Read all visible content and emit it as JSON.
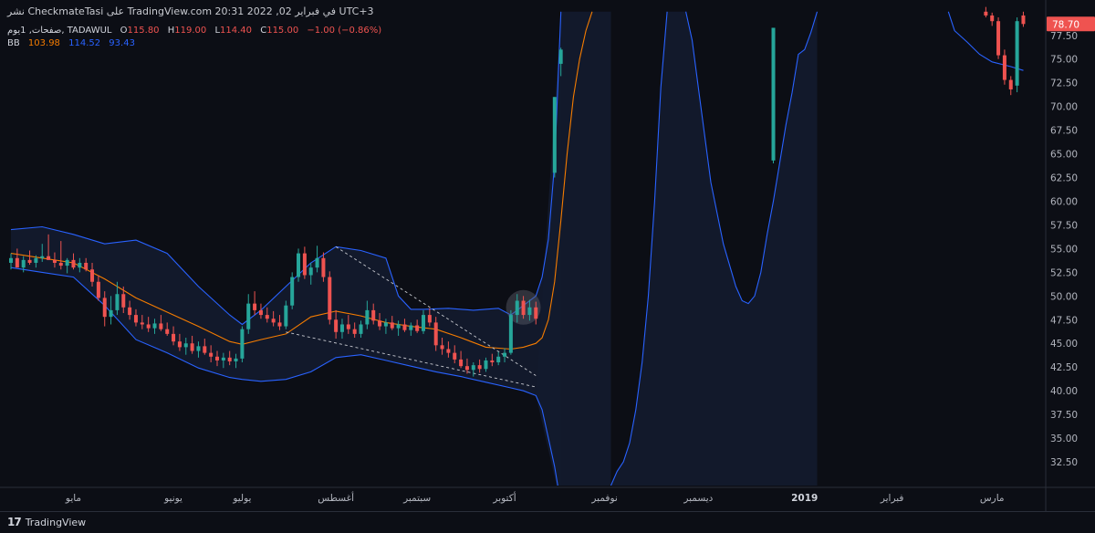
{
  "header": {
    "published_line": "نشر CheckmateTasi على TradingView.com 20:31 2022 ,02 في فبراير UTC+3"
  },
  "legend": {
    "symbol": "صفحات, 1يوم, TADAWUL",
    "open_label": "O",
    "open": "115.80",
    "high_label": "H",
    "high": "119.00",
    "low_label": "L",
    "low": "114.40",
    "close_label": "C",
    "close": "115.00",
    "change": "−1.00 (−0.86%)",
    "bb_label": "BB",
    "bb_basis": "103.98",
    "bb_upper": "114.52",
    "bb_lower": "93.43"
  },
  "price_badge": "78.70",
  "footer": {
    "brand": "TradingView",
    "logo_icon": "tradingview-logo-icon"
  },
  "colors": {
    "background": "#0c0e15",
    "up": "#26a69a",
    "down": "#ef5350",
    "basis": "#f57c00",
    "band": "#2962ff",
    "band_fill": "#131b2e",
    "grid": "#1b1e27",
    "axis_text": "#b2b5be",
    "badge": "#ef5350"
  },
  "chart_data": {
    "type": "candlestick",
    "title": "",
    "xlabel": "",
    "ylabel": "",
    "ylim": [
      30.0,
      79.5
    ],
    "grid": false,
    "y_ticks": [
      "32.50",
      "35.00",
      "37.50",
      "40.00",
      "42.50",
      "45.00",
      "47.50",
      "50.00",
      "52.50",
      "55.00",
      "57.50",
      "60.00",
      "62.50",
      "65.00",
      "67.50",
      "70.00",
      "72.50",
      "75.00",
      "77.50"
    ],
    "x_tick_labels": [
      {
        "label": "مايو",
        "i": 10
      },
      {
        "label": "يونيو",
        "i": 26
      },
      {
        "label": "يوليو",
        "i": 37
      },
      {
        "label": "أغسطس",
        "i": 52
      },
      {
        "label": "سبتمبر",
        "i": 65
      },
      {
        "label": "أكتوبر",
        "i": 79
      },
      {
        "label": "نوفمبر",
        "i": 95
      },
      {
        "label": "ديسمبر",
        "i": 110
      },
      {
        "label": "2019",
        "i": 127
      },
      {
        "label": "فبراير",
        "i": 141
      },
      {
        "label": "مارس",
        "i": 157
      }
    ],
    "candles": [
      [
        0,
        53.5,
        54.5,
        52.8,
        54.0
      ],
      [
        1,
        54.0,
        55.0,
        53.2,
        53.0
      ],
      [
        2,
        53.0,
        54.2,
        52.5,
        53.8
      ],
      [
        3,
        53.8,
        54.8,
        53.3,
        53.5
      ],
      [
        4,
        53.5,
        54.3,
        53.0,
        54.0
      ],
      [
        5,
        54.0,
        55.5,
        53.6,
        54.2
      ],
      [
        6,
        54.2,
        56.5,
        53.8,
        53.8
      ],
      [
        7,
        53.8,
        54.6,
        53.0,
        53.5
      ],
      [
        8,
        53.5,
        55.8,
        52.8,
        53.2
      ],
      [
        9,
        53.2,
        54.0,
        52.4,
        53.8
      ],
      [
        10,
        53.8,
        54.5,
        52.8,
        53.0
      ],
      [
        11,
        53.0,
        54.0,
        52.5,
        53.5
      ],
      [
        12,
        53.5,
        54.0,
        52.6,
        52.8
      ],
      [
        13,
        52.8,
        53.5,
        51.0,
        51.5
      ],
      [
        14,
        51.5,
        52.2,
        49.5,
        49.8
      ],
      [
        15,
        49.8,
        50.5,
        46.8,
        47.8
      ],
      [
        16,
        47.8,
        50.0,
        47.0,
        48.5
      ],
      [
        17,
        48.5,
        51.5,
        48.0,
        50.2
      ],
      [
        18,
        50.2,
        51.0,
        48.2,
        48.8
      ],
      [
        19,
        48.8,
        49.5,
        47.5,
        48.0
      ],
      [
        20,
        48.0,
        48.6,
        46.8,
        47.2
      ],
      [
        21,
        47.2,
        48.0,
        46.5,
        47.0
      ],
      [
        22,
        47.0,
        47.8,
        46.2,
        46.6
      ],
      [
        23,
        46.6,
        47.6,
        46.0,
        47.1
      ],
      [
        24,
        47.1,
        48.0,
        46.3,
        46.5
      ],
      [
        25,
        46.5,
        47.2,
        45.8,
        46.0
      ],
      [
        26,
        46.0,
        46.8,
        44.8,
        45.2
      ],
      [
        27,
        45.2,
        46.0,
        44.2,
        44.6
      ],
      [
        28,
        44.6,
        45.6,
        43.8,
        45.0
      ],
      [
        29,
        45.0,
        45.8,
        43.9,
        44.2
      ],
      [
        30,
        44.2,
        45.2,
        43.5,
        44.7
      ],
      [
        31,
        44.7,
        45.5,
        43.8,
        44.0
      ],
      [
        32,
        44.0,
        44.8,
        43.0,
        43.6
      ],
      [
        33,
        43.6,
        44.2,
        42.6,
        43.2
      ],
      [
        34,
        43.2,
        44.0,
        42.4,
        43.5
      ],
      [
        35,
        43.5,
        44.2,
        42.7,
        43.1
      ],
      [
        36,
        43.1,
        43.9,
        42.4,
        43.4
      ],
      [
        37,
        43.4,
        46.8,
        43.0,
        46.5
      ],
      [
        38,
        46.5,
        50.2,
        46.0,
        49.2
      ],
      [
        39,
        49.2,
        50.5,
        48.0,
        48.5
      ],
      [
        40,
        48.5,
        49.2,
        47.6,
        48.0
      ],
      [
        41,
        48.0,
        48.8,
        47.2,
        47.6
      ],
      [
        42,
        47.6,
        48.4,
        46.8,
        47.2
      ],
      [
        43,
        47.2,
        48.0,
        46.4,
        46.8
      ],
      [
        44,
        46.8,
        49.5,
        46.5,
        49.0
      ],
      [
        45,
        49.0,
        52.5,
        48.6,
        52.0
      ],
      [
        46,
        52.0,
        55.0,
        51.5,
        54.5
      ],
      [
        47,
        54.5,
        55.2,
        51.8,
        52.2
      ],
      [
        48,
        52.2,
        53.5,
        51.2,
        53.0
      ],
      [
        49,
        53.0,
        55.3,
        52.5,
        54.0
      ],
      [
        50,
        54.0,
        54.6,
        51.5,
        52.0
      ],
      [
        51,
        52.0,
        52.6,
        47.0,
        47.5
      ],
      [
        52,
        47.5,
        48.5,
        45.5,
        46.2
      ],
      [
        53,
        46.2,
        47.6,
        45.5,
        47.0
      ],
      [
        54,
        47.0,
        48.0,
        46.0,
        46.5
      ],
      [
        55,
        46.5,
        47.2,
        45.6,
        46.0
      ],
      [
        56,
        46.0,
        47.4,
        45.6,
        47.0
      ],
      [
        57,
        47.0,
        49.5,
        46.5,
        48.5
      ],
      [
        58,
        48.5,
        49.2,
        47.0,
        47.4
      ],
      [
        59,
        47.4,
        48.2,
        46.4,
        46.8
      ],
      [
        60,
        46.8,
        47.6,
        46.0,
        47.2
      ],
      [
        61,
        47.2,
        47.9,
        46.4,
        46.6
      ],
      [
        62,
        46.6,
        47.4,
        45.8,
        47.0
      ],
      [
        63,
        47.0,
        47.6,
        46.2,
        46.4
      ],
      [
        64,
        46.4,
        47.2,
        45.8,
        46.9
      ],
      [
        65,
        46.9,
        47.5,
        46.1,
        46.3
      ],
      [
        66,
        46.3,
        48.5,
        46.0,
        48.0
      ],
      [
        67,
        48.0,
        48.7,
        46.8,
        47.2
      ],
      [
        68,
        47.2,
        47.8,
        44.2,
        44.8
      ],
      [
        69,
        44.8,
        45.6,
        43.8,
        44.4
      ],
      [
        70,
        44.4,
        45.2,
        43.5,
        44.0
      ],
      [
        71,
        44.0,
        44.8,
        42.9,
        43.3
      ],
      [
        72,
        43.3,
        44.2,
        42.4,
        42.6
      ],
      [
        73,
        42.6,
        43.4,
        41.8,
        42.2
      ],
      [
        74,
        42.2,
        43.0,
        41.5,
        42.7
      ],
      [
        75,
        42.7,
        43.3,
        41.9,
        42.3
      ],
      [
        76,
        42.3,
        43.5,
        42.0,
        43.2
      ],
      [
        77,
        43.2,
        43.9,
        42.6,
        43.0
      ],
      [
        78,
        43.0,
        44.1,
        42.7,
        43.6
      ],
      [
        79,
        43.6,
        44.5,
        43.0,
        44.0
      ],
      [
        80,
        44.0,
        48.5,
        43.8,
        48.0
      ],
      [
        81,
        48.0,
        50.2,
        47.2,
        49.5
      ],
      [
        82,
        49.5,
        50.0,
        47.6,
        48.0
      ],
      [
        83,
        48.0,
        49.6,
        47.4,
        48.8
      ],
      [
        84,
        48.8,
        49.4,
        47.0,
        47.6
      ],
      [
        87,
        63.0,
        71.0,
        62.5,
        71.0
      ],
      [
        88,
        74.5,
        76.2,
        73.2,
        76.0
      ],
      [
        122,
        64.3,
        78.3,
        64.0,
        78.3
      ],
      [
        156,
        80.0,
        80.5,
        79.4,
        79.6
      ],
      [
        157,
        79.6,
        79.9,
        78.5,
        79.0
      ],
      [
        158,
        79.0,
        79.4,
        75.0,
        75.4
      ],
      [
        159,
        75.4,
        76.0,
        72.3,
        72.8
      ],
      [
        160,
        72.8,
        73.2,
        71.2,
        71.8
      ],
      [
        161,
        72.2,
        79.4,
        71.5,
        79.0
      ],
      [
        162,
        79.6,
        80.0,
        78.4,
        78.7
      ]
    ],
    "series": [
      {
        "name": "",
        "role": "upper",
        "points": [
          [
            0,
            57.0
          ],
          [
            5,
            57.3
          ],
          [
            10,
            56.5
          ],
          [
            15,
            55.5
          ],
          [
            20,
            55.9
          ],
          [
            25,
            54.5
          ],
          [
            30,
            51.0
          ],
          [
            35,
            48.0
          ],
          [
            37,
            47.0
          ],
          [
            40,
            48.5
          ],
          [
            44,
            51.0
          ],
          [
            48,
            53.5
          ],
          [
            52,
            55.2
          ],
          [
            56,
            54.8
          ],
          [
            60,
            54.0
          ],
          [
            62,
            50.0
          ],
          [
            64,
            48.6
          ],
          [
            66,
            48.6
          ],
          [
            70,
            48.7
          ],
          [
            74,
            48.5
          ],
          [
            78,
            48.7
          ],
          [
            80,
            48.0
          ],
          [
            82,
            49.0
          ],
          [
            84,
            50.0
          ],
          [
            85,
            52.0
          ],
          [
            86,
            56.0
          ],
          [
            87,
            64.0
          ],
          [
            88,
            80.0
          ]
        ]
      },
      {
        "name": "",
        "role": "basis",
        "points": [
          [
            0,
            54.5
          ],
          [
            5,
            54.0
          ],
          [
            10,
            53.5
          ],
          [
            15,
            51.8
          ],
          [
            20,
            49.8
          ],
          [
            25,
            48.3
          ],
          [
            30,
            46.8
          ],
          [
            35,
            45.2
          ],
          [
            37,
            44.9
          ],
          [
            40,
            45.4
          ],
          [
            44,
            46.0
          ],
          [
            48,
            47.8
          ],
          [
            52,
            48.4
          ],
          [
            56,
            47.9
          ],
          [
            60,
            47.2
          ],
          [
            64,
            46.8
          ],
          [
            68,
            46.5
          ],
          [
            72,
            45.6
          ],
          [
            76,
            44.6
          ],
          [
            80,
            44.4
          ],
          [
            82,
            44.6
          ],
          [
            84,
            45.0
          ],
          [
            85,
            45.6
          ],
          [
            86,
            47.5
          ],
          [
            87,
            51.5
          ],
          [
            88,
            58.0
          ],
          [
            89,
            65.0
          ],
          [
            90,
            71.0
          ],
          [
            91,
            75.0
          ],
          [
            92,
            78.0
          ],
          [
            93,
            80.0
          ]
        ]
      },
      {
        "name": "",
        "role": "lower",
        "points": [
          [
            0,
            53.0
          ],
          [
            5,
            52.5
          ],
          [
            10,
            52.0
          ],
          [
            15,
            49.0
          ],
          [
            20,
            45.4
          ],
          [
            25,
            44.0
          ],
          [
            30,
            42.4
          ],
          [
            35,
            41.4
          ],
          [
            37,
            41.2
          ],
          [
            40,
            41.0
          ],
          [
            44,
            41.2
          ],
          [
            48,
            42.0
          ],
          [
            52,
            43.5
          ],
          [
            56,
            43.8
          ],
          [
            60,
            43.2
          ],
          [
            64,
            42.6
          ],
          [
            68,
            42.0
          ],
          [
            72,
            41.5
          ],
          [
            76,
            40.9
          ],
          [
            80,
            40.3
          ],
          [
            82,
            40.0
          ],
          [
            84,
            39.5
          ],
          [
            85,
            38.0
          ],
          [
            86,
            35.0
          ],
          [
            87,
            32.0
          ],
          [
            88,
            28.0
          ]
        ]
      },
      {
        "name": "",
        "role": "upper",
        "points": [
          [
            108,
            80.0
          ],
          [
            109,
            77.0
          ],
          [
            110,
            72.0
          ],
          [
            112,
            62.0
          ],
          [
            114,
            55.5
          ],
          [
            116,
            51.0
          ],
          [
            117,
            49.5
          ],
          [
            118,
            49.2
          ],
          [
            119,
            50.0
          ],
          [
            120,
            52.5
          ],
          [
            121,
            56.5
          ],
          [
            122,
            60.0
          ],
          [
            123,
            64.0
          ],
          [
            124,
            68.0
          ],
          [
            125,
            71.5
          ],
          [
            126,
            75.5
          ],
          [
            127,
            76.0
          ],
          [
            128,
            77.8
          ],
          [
            129,
            80.0
          ]
        ]
      },
      {
        "name": "",
        "role": "lower",
        "points": [
          [
            96,
            30.0
          ],
          [
            97,
            31.5
          ],
          [
            98,
            32.5
          ],
          [
            99,
            34.5
          ],
          [
            100,
            38.0
          ],
          [
            101,
            43.0
          ],
          [
            102,
            50.0
          ],
          [
            103,
            60.0
          ],
          [
            104,
            72.0
          ],
          [
            105,
            80.0
          ]
        ]
      },
      {
        "name": "",
        "role": "upper",
        "points": [
          [
            150,
            80.0
          ],
          [
            151,
            78.0
          ],
          [
            153,
            76.8
          ],
          [
            155,
            75.5
          ],
          [
            157,
            74.7
          ],
          [
            160,
            74.2
          ],
          [
            162,
            73.8
          ]
        ]
      }
    ],
    "trendlines": [
      {
        "from": [
          52,
          55.2
        ],
        "to": [
          84,
          41.6
        ]
      },
      {
        "from": [
          44,
          46.2
        ],
        "to": [
          84,
          40.4
        ]
      }
    ],
    "highlight": {
      "center": [
        82,
        48.8
      ]
    }
  }
}
